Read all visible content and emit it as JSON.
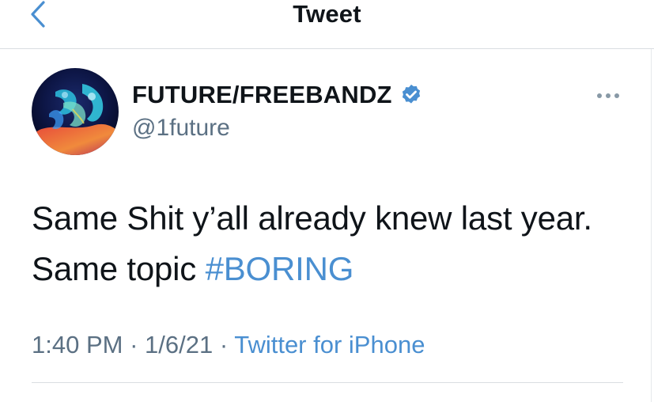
{
  "header": {
    "title": "Tweet",
    "back_icon": "chevron-left-icon"
  },
  "author": {
    "display_name": "FUTURE/FREEBANDZ",
    "handle": "@1future",
    "verified": true,
    "verified_icon": "verified-badge-icon"
  },
  "menu": {
    "more_icon": "more-horizontal-icon"
  },
  "tweet": {
    "text_line1": "Same Shit y’all already knew last year.",
    "text_line2_prefix": "Same topic ",
    "hashtag": "#BORING"
  },
  "meta": {
    "time": "1:40 PM",
    "separator1": " · ",
    "date": "1/6/21",
    "separator2": " · ",
    "source": "Twitter for iPhone"
  },
  "colors": {
    "accent": "#4a8fd1",
    "text": "#0f1419",
    "secondary": "#5b7083",
    "divider": "#d9dde1"
  }
}
